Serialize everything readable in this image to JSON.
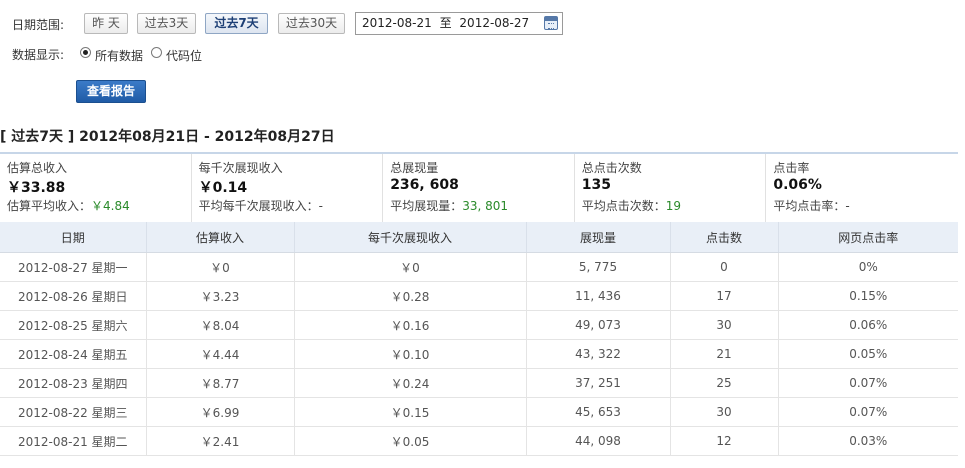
{
  "filters": {
    "date_range_label": "日期范围:",
    "quick_buttons": [
      "昨 天",
      "过去3天",
      "过去7天",
      "过去30天"
    ],
    "active_button": "过去7天",
    "date_from": "2012-08-21",
    "date_sep": "至",
    "date_to": "2012-08-27",
    "display_label": "数据显示:",
    "radio_all": "所有数据",
    "radio_code": "代码位",
    "submit_label": "查看报告"
  },
  "period": {
    "title": "[ 过去7天 ] 2012年08月21日 - 2012年08月27日"
  },
  "summary": [
    {
      "label": "估算总收入",
      "value": "￥33.88",
      "avg_label": "估算平均收入：",
      "avg_value": "￥4.84"
    },
    {
      "label": "每千次展现收入",
      "value": "￥0.14",
      "avg_label": "平均每千次展现收入：",
      "avg_value": "-"
    },
    {
      "label": "总展现量",
      "value": "236, 608",
      "avg_label": "平均展现量：",
      "avg_value": "33, 801"
    },
    {
      "label": "总点击次数",
      "value": "135",
      "avg_label": "平均点击次数：",
      "avg_value": "19"
    },
    {
      "label": "点击率",
      "value": "0.06%",
      "avg_label": "平均点击率：",
      "avg_value": "-"
    }
  ],
  "table": {
    "headers": [
      "日期",
      "估算收入",
      "每千次展现收入",
      "展现量",
      "点击数",
      "网页点击率"
    ],
    "rows": [
      [
        "2012-08-27 星期一",
        "￥0",
        "￥0",
        "5, 775",
        "0",
        "0%"
      ],
      [
        "2012-08-26 星期日",
        "￥3.23",
        "￥0.28",
        "11, 436",
        "17",
        "0.15%"
      ],
      [
        "2012-08-25 星期六",
        "￥8.04",
        "￥0.16",
        "49, 073",
        "30",
        "0.06%"
      ],
      [
        "2012-08-24 星期五",
        "￥4.44",
        "￥0.10",
        "43, 322",
        "21",
        "0.05%"
      ],
      [
        "2012-08-23 星期四",
        "￥8.77",
        "￥0.24",
        "37, 251",
        "25",
        "0.07%"
      ],
      [
        "2012-08-22 星期三",
        "￥6.99",
        "￥0.15",
        "45, 653",
        "30",
        "0.07%"
      ],
      [
        "2012-08-21 星期二",
        "￥2.41",
        "￥0.05",
        "44, 098",
        "12",
        "0.03%"
      ]
    ]
  },
  "colors": {
    "accent": "#1f5ba6",
    "avg_value": "#2a8a2a",
    "header_bg": "#e9eff7"
  }
}
